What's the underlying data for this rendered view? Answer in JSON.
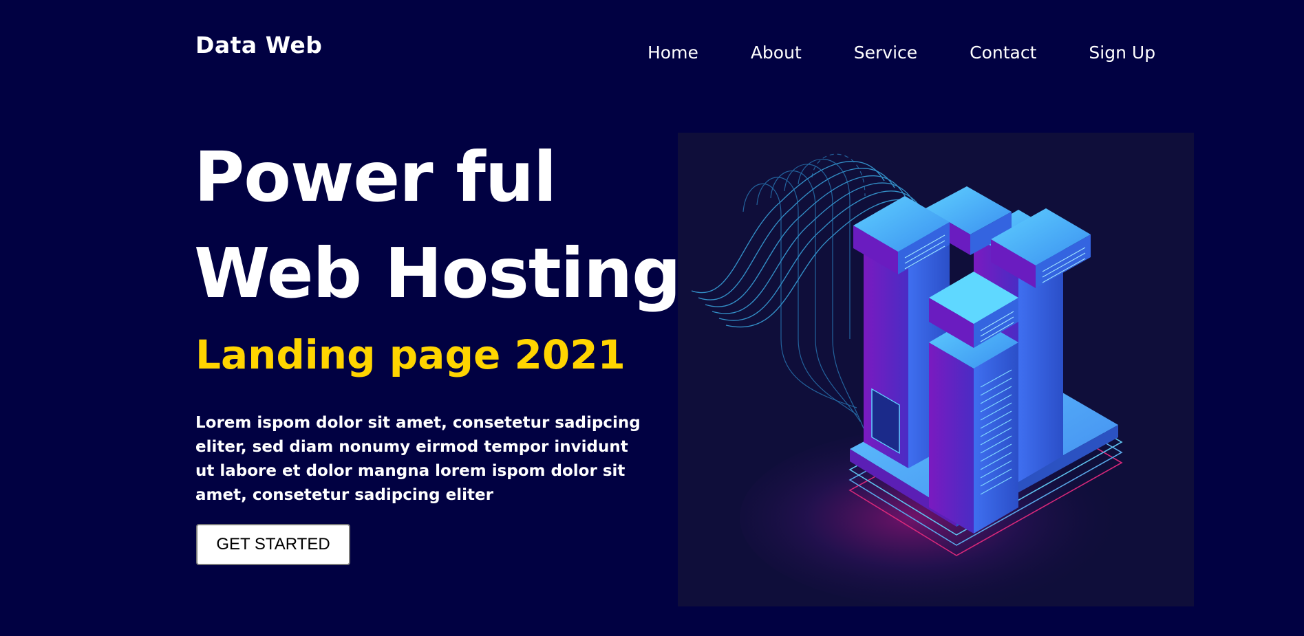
{
  "header": {
    "logo": "Data Web",
    "nav": [
      "Home",
      "About",
      "Service",
      "Contact",
      "Sign Up"
    ]
  },
  "hero": {
    "title_line1": "Power ful",
    "title_line2": "Web Hosting",
    "subtitle": "Landing page 2021",
    "description": "Lorem ispom dolor sit amet, consetetur sadipcing eliter, sed diam nonumy eirmod tempor invidunt ut labore et dolor mangna lorem ispom dolor sit amet, consetetur sadipcing eliter",
    "cta_label": "GET STARTED"
  },
  "colors": {
    "background": "#010142",
    "accent": "#ffd500",
    "text": "#ffffff",
    "illustration_bg": "#0f0e3a"
  },
  "illustration": {
    "icon": "server-racks-illustration"
  }
}
